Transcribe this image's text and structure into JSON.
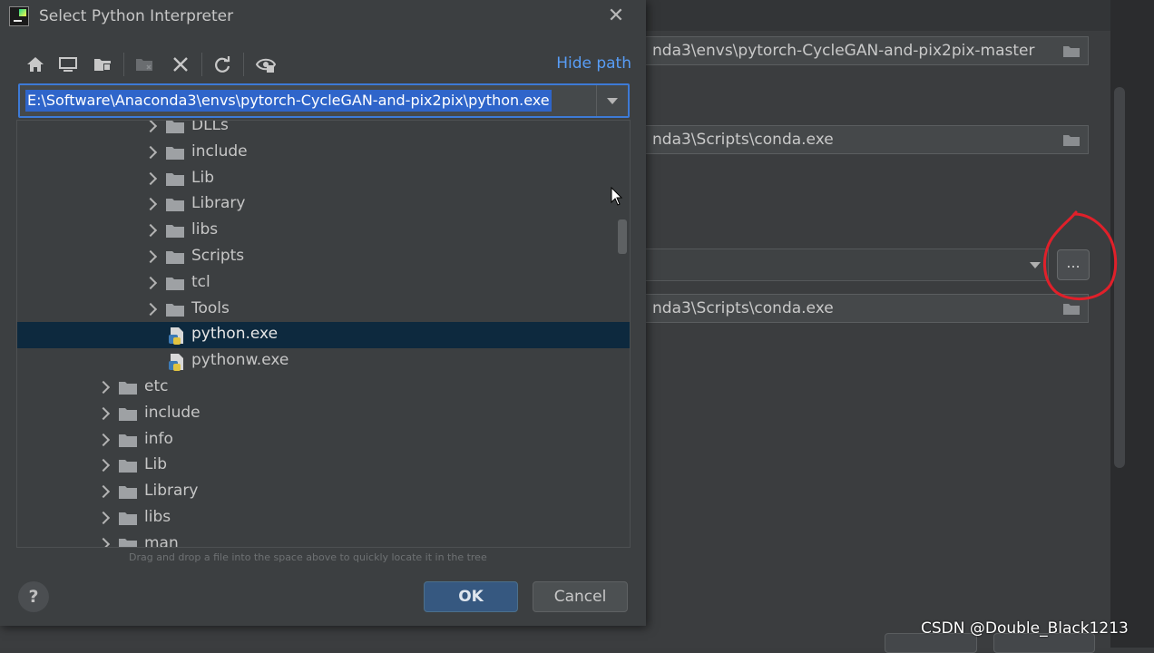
{
  "dialog": {
    "title": "Select Python Interpreter",
    "hide_path_label": "Hide path",
    "path_value": "E:\\Software\\Anaconda3\\envs\\pytorch-CycleGAN-and-pix2pix\\python.exe",
    "hint": "Drag and drop a file into the space above to quickly locate it in the tree",
    "ok_label": "OK",
    "cancel_label": "Cancel",
    "help_label": "?"
  },
  "toolbar": {
    "icons": [
      "home-icon",
      "desktop-icon",
      "project-icon",
      "new-folder-icon",
      "delete-icon",
      "refresh-icon",
      "show-hidden-icon"
    ]
  },
  "tree": {
    "items": [
      {
        "label": "DLLs",
        "type": "folder",
        "level": 2,
        "selected": false
      },
      {
        "label": "include",
        "type": "folder",
        "level": 2,
        "selected": false
      },
      {
        "label": "Lib",
        "type": "folder",
        "level": 2,
        "selected": false
      },
      {
        "label": "Library",
        "type": "folder",
        "level": 2,
        "selected": false
      },
      {
        "label": "libs",
        "type": "folder",
        "level": 2,
        "selected": false
      },
      {
        "label": "Scripts",
        "type": "folder",
        "level": 2,
        "selected": false
      },
      {
        "label": "tcl",
        "type": "folder",
        "level": 2,
        "selected": false
      },
      {
        "label": "Tools",
        "type": "folder",
        "level": 2,
        "selected": false
      },
      {
        "label": "python.exe",
        "type": "file",
        "level": 2,
        "selected": true
      },
      {
        "label": "pythonw.exe",
        "type": "file",
        "level": 2,
        "selected": false
      },
      {
        "label": "etc",
        "type": "folder",
        "level": 1,
        "selected": false
      },
      {
        "label": "include",
        "type": "folder",
        "level": 1,
        "selected": false
      },
      {
        "label": "info",
        "type": "folder",
        "level": 1,
        "selected": false
      },
      {
        "label": "Lib",
        "type": "folder",
        "level": 1,
        "selected": false
      },
      {
        "label": "Library",
        "type": "folder",
        "level": 1,
        "selected": false
      },
      {
        "label": "libs",
        "type": "folder",
        "level": 1,
        "selected": false
      },
      {
        "label": "man",
        "type": "folder",
        "level": 1,
        "selected": false
      }
    ]
  },
  "background": {
    "field_1": "nda3\\envs\\pytorch-CycleGAN-and-pix2pix-master",
    "field_2": "nda3\\Scripts\\conda.exe",
    "field_3": "nda3\\Scripts\\conda.exe",
    "ellipsis_label": "..."
  },
  "watermark": "CSDN @Double_Black1213",
  "colors": {
    "accent": "#589df6",
    "selection": "#0d293e",
    "ok_button": "#365880",
    "annotation": "#e0202a"
  }
}
